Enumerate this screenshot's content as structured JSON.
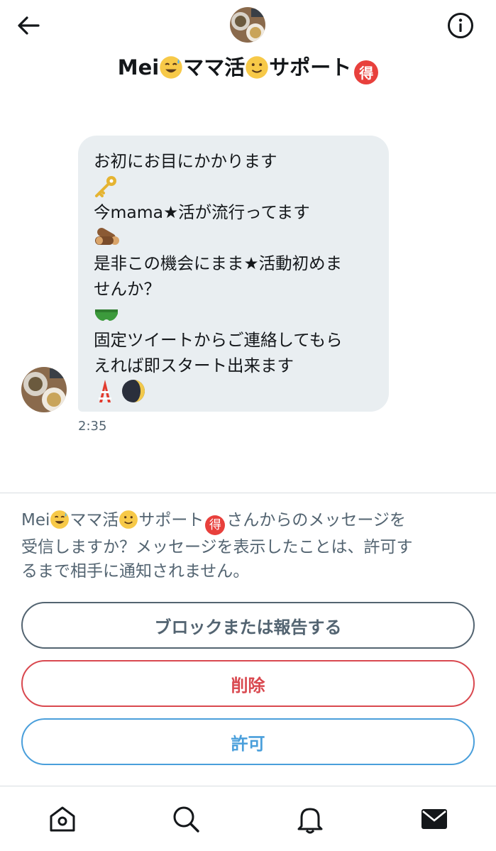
{
  "header": {
    "title_prefix": "Mei",
    "title_mid": "ママ活",
    "title_suffix": "サポート",
    "title_badge": "得"
  },
  "message": {
    "lines": [
      "お初にお目にかかります",
      "今mama★活が流行ってます",
      "是非この機会にまま★活動初めま",
      "せんか？",
      "固定ツイートからご連絡してもら",
      "えれば即スタート出来ます"
    ],
    "time": "2:35"
  },
  "request": {
    "text_a": "Mei",
    "text_b": "ママ活",
    "text_c": "サポート",
    "text_badge": "得",
    "text_d": "さんからのメッセージを",
    "line2": "受信しますか？メッセージを表示したことは、許可す",
    "line3": "るまで相手に通知されません。"
  },
  "buttons": {
    "block": "ブロックまたは報告する",
    "delete": "削除",
    "allow": "許可"
  },
  "colors": {
    "block": "#536471",
    "delete": "#d9484f",
    "allow": "#4a9fdb",
    "bubble": "#e9eef1"
  },
  "icons": [
    "back-arrow-icon",
    "info-icon",
    "home-icon",
    "search-icon",
    "bell-icon",
    "mail-icon"
  ]
}
